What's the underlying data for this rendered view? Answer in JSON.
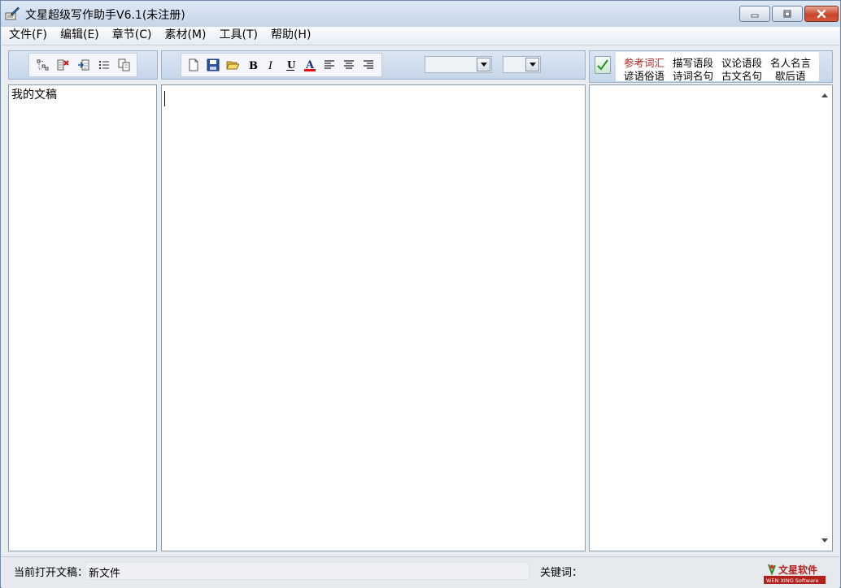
{
  "window": {
    "title": "文星超级写作助手V6.1(未注册)",
    "buttons": {
      "minimize": "minimize",
      "maximize": "maximize",
      "close": "close"
    }
  },
  "menu": [
    "文件(F)",
    "编辑(E)",
    "章节(C)",
    "素材(M)",
    "工具(T)",
    "帮助(H)"
  ],
  "outline_toolbar": {
    "icons": [
      "add-chapter-icon",
      "delete-chapter-icon",
      "import-icon",
      "list-icon",
      "copy-icon"
    ]
  },
  "editor_toolbar": {
    "icons": [
      "new-file-icon",
      "save-icon",
      "open-folder-icon",
      "bold-icon",
      "italic-icon",
      "underline-icon",
      "font-color-icon",
      "align-left-icon",
      "align-center-icon",
      "align-right-icon"
    ],
    "font_value": "",
    "size_value": ""
  },
  "outline": {
    "root": "我的文稿"
  },
  "editor": {
    "content": ""
  },
  "materials": {
    "items": [
      {
        "label": "参考词汇",
        "active": true
      },
      {
        "label": "描写语段",
        "active": false
      },
      {
        "label": "议论语段",
        "active": false
      },
      {
        "label": "名人名言",
        "active": false
      },
      {
        "label": "谚语俗语",
        "active": false
      },
      {
        "label": "诗词名句",
        "active": false
      },
      {
        "label": "古文名句",
        "active": false
      },
      {
        "label": "歇后语",
        "active": false
      }
    ],
    "accent_color": "#b3221a"
  },
  "status": {
    "current_doc_label": "当前打开文稿：",
    "current_doc_value": "新文件",
    "keyword_label": "关键词：",
    "keyword_value": "",
    "logo_text": "文星软件",
    "logo_subtext": "WEN XING Software"
  }
}
